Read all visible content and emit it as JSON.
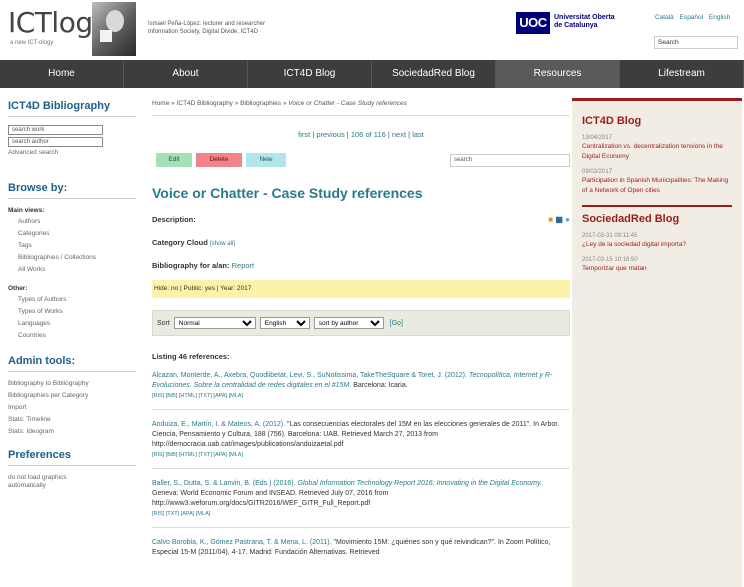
{
  "header": {
    "logo": "ICTlogy",
    "logo_sub": "a new ICT-ology",
    "owner_line1": "Ismael Peña-López: lecturer and researcher",
    "owner_line2": "Information Society, Digital Divide, ICT4D",
    "uoc_logo": "UOC",
    "uoc_name_1": "Universitat Oberta",
    "uoc_name_2": "de Catalunya",
    "languages": [
      "Català",
      "Español",
      "English"
    ],
    "search_placeholder": "Search"
  },
  "nav": {
    "items": [
      "Home",
      "About",
      "ICT4D Blog",
      "SociedadRed Blog",
      "Resources",
      "Lifestream"
    ],
    "active": "Resources"
  },
  "sidebar": {
    "title": "ICT4D Bibliography",
    "search_work": "search work",
    "search_author": "search author",
    "advanced": "Advanced search",
    "browse_title": "Browse by:",
    "main_views_label": "Main views:",
    "main_views": [
      "Authors",
      "Categories",
      "Tags",
      "Bibliographies / Collections",
      "All Works"
    ],
    "other_label": "Other:",
    "other": [
      "Types of Authors",
      "Types of Works",
      "Languages",
      "Countries"
    ],
    "admin_title": "Admin tools:",
    "admin": [
      "Bibliography to Bibliography",
      "Bibliographies per Category",
      "Import",
      "Stats: Timeline",
      "Stats: Ideogram"
    ],
    "pref_title": "Preferences",
    "pref_1": "do not load graphics",
    "pref_2": "automatically"
  },
  "main": {
    "breadcrumb_home": "Home",
    "breadcrumb_sep": " » ",
    "breadcrumb_bib": "ICT4D Bibliography",
    "breadcrumb_bibs": "Bibliographies",
    "breadcrumb_current": "Voice or Chatter - Case Study references",
    "pager_first": "first",
    "pager_prev": "previous",
    "pager_pos": "106 of 116",
    "pager_next": "next",
    "pager_last": "last",
    "btn_edit": "Edit",
    "btn_delete": "Delete",
    "btn_new": "New",
    "search_placeholder": "search",
    "title": "Voice or Chatter - Case Study references",
    "description_label": "Description:",
    "category_cloud_label": "Category Cloud",
    "category_cloud_sub": "[show all]",
    "bib_for_label": "Bibliography for a/an:",
    "bib_for_value": "Report",
    "meta": "Hide: no  |  Public: yes  |  Year: 2017",
    "sort_label": "Sort",
    "sort_option_1": "Normal",
    "sort_option_2": "English",
    "sort_option_3": "sort by author",
    "go": "[Go]",
    "listing": "Listing 46 references:",
    "refs": [
      {
        "authors": "Alcazan, Monterde, A., Axebra, Quodlibetat, Levi, S., SuNotissima, TakeTheSquare & Toret, J. (2012).",
        "title": "Tecnopolítica, Internet y R-Evoluciones. Sobre la centralidad de redes digitales en el #15M.",
        "rest": "Barcelona: Icaria.",
        "links": "[RIS] [BiB] [HTML] [TXT] [APA] [MLA]"
      },
      {
        "authors": "Anduiza, E., Martín, I. & Mateos, A. (2012).",
        "title": "\"Las consecuencias electorales del 15M en las elecciones generales de 2011\". In Arbor. Ciencia, Pensamiento y Cultura, 188 (756).",
        "rest": "Barcelona: UAB. Retrieved March 27, 2013 from http://democracia.uab.cat/images/publications/anduizaetal.pdf",
        "links": "[RIS] [BiB] [HTML] [TXT] [APA] [MLA]"
      },
      {
        "authors": "Baller, S., Dutta, S. & Lanvin, B. (Eds.) (2016).",
        "title": "Global Information Technology Report 2016: Innovating in the Digital Economy.",
        "rest": "Geneva: World Economic Forum and INSEAD. Retrieved July 07, 2016 from http://www3.weforum.org/docs/GITR2016/WEF_GITR_Full_Report.pdf",
        "links": "[RIS] [TXT] [APA] [MLA]"
      },
      {
        "authors": "Calvo Borobia, K., Gómez Pastrana, T. & Mena, L. (2011).",
        "title": "\"Movimiento 15M: ¿quiénes son y qué reivindican?\". In Zoom Político,",
        "rest": "Especial 15-M (2011/04), 4-17. Madrid: Fundación Alternativas. Retrieved",
        "links": ""
      }
    ]
  },
  "rside": {
    "blog1_title": "ICT4D Blog",
    "blog1_posts": [
      {
        "date": "13/04/2017",
        "title": "Centralization vs. decentralization tensions in the Digital Economy"
      },
      {
        "date": "09/03/2017",
        "title": "Participation in Spanish Municipalities: The Making of a Network of Open cities"
      }
    ],
    "blog2_title": "SociedadRed Blog",
    "blog2_posts": [
      {
        "date": "2017-03-31 09:11:45",
        "title": "¿Ley de la sociedad digital importa?"
      },
      {
        "date": "2017-03-15 10:16:50",
        "title": "Temporizar que matan"
      }
    ]
  }
}
